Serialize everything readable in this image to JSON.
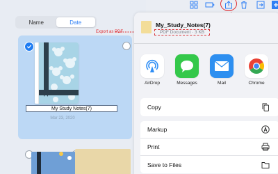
{
  "sort_control": {
    "options": [
      "Name",
      "Date"
    ],
    "selected": "Date"
  },
  "note": {
    "title": "My Study Notes(7)",
    "date": "Mar 23, 2020"
  },
  "annotation": {
    "export_label": "Export as PDF"
  },
  "toolbar": {
    "icons": [
      "grid-icon",
      "tag-icon",
      "share-icon",
      "trash-icon",
      "export-icon",
      "add-icon"
    ]
  },
  "share_sheet": {
    "doc_name": "My_Study_Notes(7)",
    "doc_meta": "PDF Document · 3 KB",
    "apps": [
      {
        "label": "AirDrop",
        "icon": "airdrop-icon"
      },
      {
        "label": "Messages",
        "icon": "messages-icon"
      },
      {
        "label": "Mail",
        "icon": "mail-icon"
      },
      {
        "label": "Chrome",
        "icon": "chrome-icon"
      }
    ],
    "actions": [
      "Copy",
      "Markup",
      "Print",
      "Save to Files"
    ]
  },
  "colors": {
    "accent": "#2f7ff5",
    "annotation_red": "#e0282c",
    "selected_card": "#bcd8f5"
  }
}
